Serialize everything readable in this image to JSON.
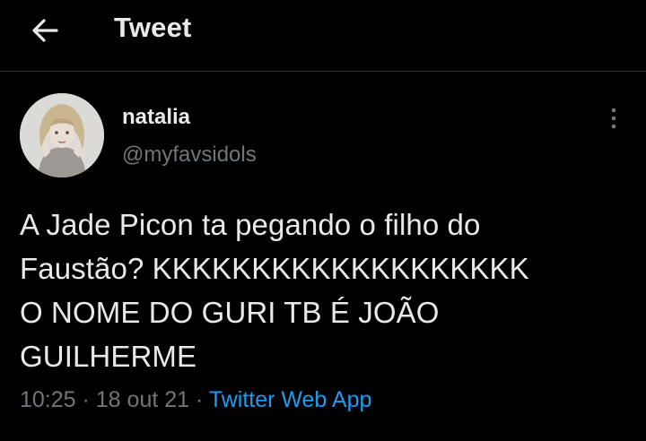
{
  "header": {
    "back_icon": "arrow-left-icon",
    "title": "Tweet"
  },
  "author": {
    "avatar": "profile-photo",
    "display_name": "natalia",
    "handle": "@myfavsidols"
  },
  "more_icon": "more-vertical-icon",
  "tweet": {
    "text": "A Jade Picon ta pegando o filho do\nFaustão? KKKKKKKKKKKKKKKKKKK\nO NOME DO GURI TB É JOÃO\nGUILHERME",
    "time": "10:25",
    "separator": " · ",
    "date": "18 out 21",
    "source": "Twitter Web App"
  },
  "colors": {
    "background": "#000000",
    "text": "#e7e9ea",
    "muted": "#71767b",
    "link": "#1d9bf0",
    "divider": "#2f3336"
  }
}
